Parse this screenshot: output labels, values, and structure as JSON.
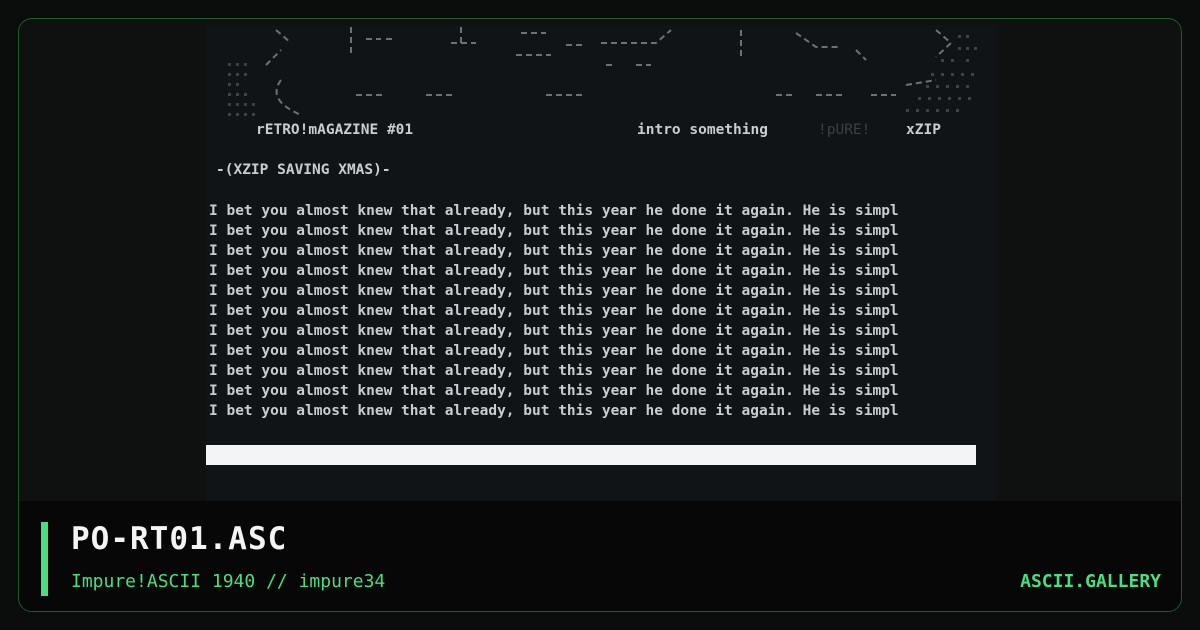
{
  "screenshot": {
    "header_left": "rETRO!mAGAZINE #01",
    "header_mid": "intro something",
    "header_ghost": "!pURE!",
    "header_right": "xZIP",
    "section": "-(XZIP SAVING XMAS)-",
    "body_line": "I bet you almost knew that already, but this year he done it again. He is simpl",
    "body_line_count": 11
  },
  "footer": {
    "title": "PO-RT01.ASC",
    "subtitle": "Impure!ASCII 1940 // impure34",
    "brand": "ASCII.GALLERY"
  },
  "colors": {
    "accent": "#4ade80",
    "border": "#1f5a2c",
    "screen_bg": "#111417",
    "footer_bg": "#070707"
  }
}
